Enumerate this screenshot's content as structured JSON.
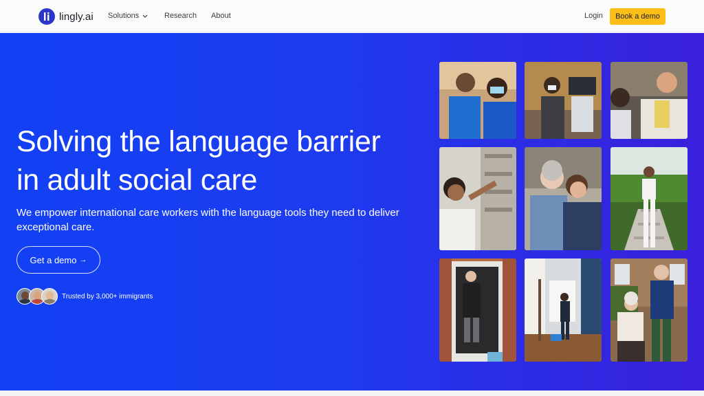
{
  "nav": {
    "logo_text": "lingly.ai",
    "items": [
      {
        "label": "Solutions"
      },
      {
        "label": "Research"
      },
      {
        "label": "About"
      }
    ],
    "login_label": "Login",
    "cta_label": "Book a demo"
  },
  "hero": {
    "title_line1": "Solving the language barrier",
    "title_line2": "in adult social care",
    "subtitle": "We empower international care workers with the language tools they need to deliver exceptional care.",
    "cta_label": "Get a demo",
    "cta_arrow": "→",
    "trusted_text": "Trusted by 3,000+ immigrants"
  },
  "colors": {
    "brand_blue": "#1240f3",
    "brand_violet": "#3a1fdc",
    "cta_yellow": "#fbbd17"
  },
  "photos": [
    {
      "name": "photo-nurses-masked"
    },
    {
      "name": "photo-clinician-ultrasound"
    },
    {
      "name": "photo-carer-with-patient"
    },
    {
      "name": "photo-pharmacy-worker"
    },
    {
      "name": "photo-elderly-woman-hug"
    },
    {
      "name": "photo-nurse-on-stairs"
    },
    {
      "name": "photo-elderly-man-doorway"
    },
    {
      "name": "photo-cleaning-hallway"
    },
    {
      "name": "photo-elderly-couple-garden"
    }
  ]
}
